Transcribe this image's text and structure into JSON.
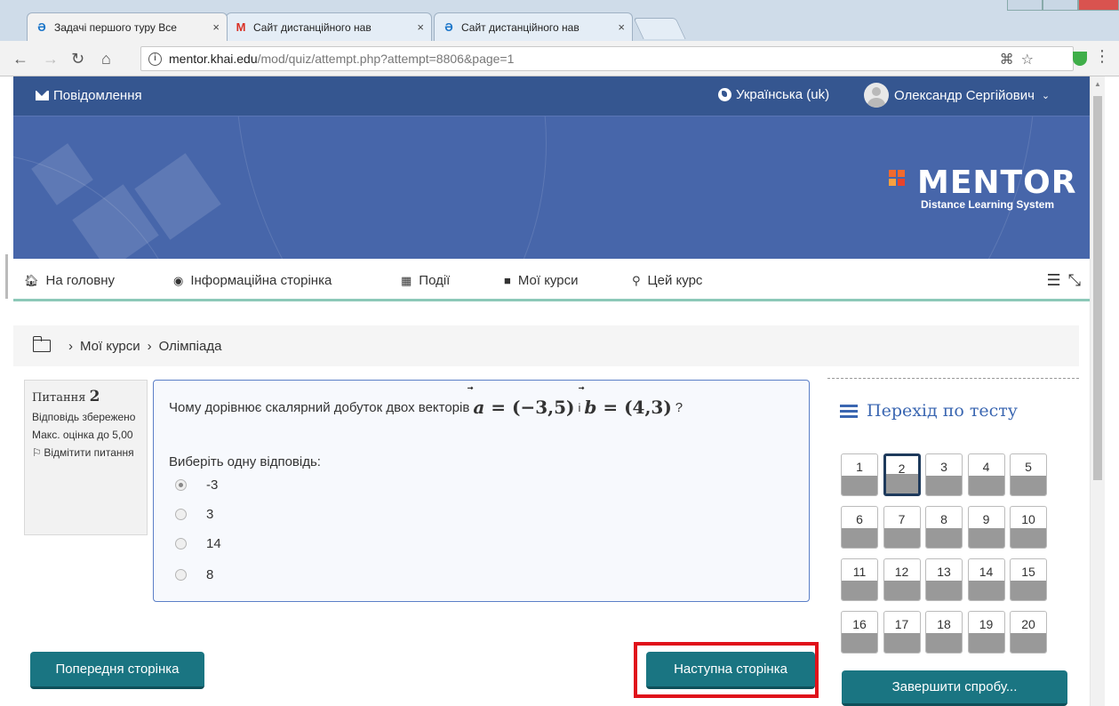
{
  "browser": {
    "tabs": [
      {
        "title": "Задачі першого туру Все",
        "icon": "moodle-icon",
        "close": "×"
      },
      {
        "title": "Сайт дистанційного нав",
        "icon": "gmail-icon",
        "close": "×"
      },
      {
        "title": "Сайт дистанційного нав",
        "icon": "moodle-icon",
        "close": "×"
      }
    ],
    "url_host": "mentor.khai.edu",
    "url_path": "/mod/quiz/attempt.php?attempt=8806&page=1"
  },
  "topnav": {
    "messages": "Повідомлення",
    "language": "Українська (uk)",
    "user": "Олександр Сергійович"
  },
  "logo": {
    "word": "MENTOR",
    "subtitle": "Distance Learning System"
  },
  "mainnav": {
    "items": [
      {
        "label": "На головну",
        "icon": "home-icon"
      },
      {
        "label": "Інформаційна сторінка",
        "icon": "dashboard-icon"
      },
      {
        "label": "Події",
        "icon": "calendar-icon"
      },
      {
        "label": "Мої курси",
        "icon": "briefcase-icon"
      },
      {
        "label": "Цей курс",
        "icon": "sitemap-icon"
      }
    ]
  },
  "breadcrumb": {
    "items": [
      "Мої курси",
      "Олімпіада"
    ]
  },
  "question": {
    "label": "Питання",
    "number": "2",
    "status": "Відповідь збережено",
    "max_mark": "Макс. оцінка до 5,00",
    "flag": "Відмітити питання",
    "text_before": "Чому дорівнює скалярний добуток двох векторів",
    "vector_a": "a",
    "vector_a_value": "(−3,5)",
    "conj": "і",
    "vector_b": "b",
    "vector_b_value": "(4,3)",
    "text_after": "?",
    "prompt": "Виберіть одну відповідь:",
    "options": [
      "-3",
      "3",
      "14",
      "8"
    ],
    "selected_index": 0
  },
  "quiz_nav": {
    "title": "Перехід по тесту",
    "questions": [
      "1",
      "2",
      "3",
      "4",
      "5",
      "6",
      "7",
      "8",
      "9",
      "10",
      "11",
      "12",
      "13",
      "14",
      "15",
      "16",
      "17",
      "18",
      "19",
      "20"
    ],
    "current": "2",
    "finish": "Завершити спробу..."
  },
  "buttons": {
    "prev": "Попередня сторінка",
    "next": "Наступна сторінка"
  },
  "colors": {
    "navbar": "#355690",
    "banner": "#4766aa",
    "button": "#1a7582",
    "highlight": "#e0111a",
    "accent_line": "#8cc8b8"
  }
}
